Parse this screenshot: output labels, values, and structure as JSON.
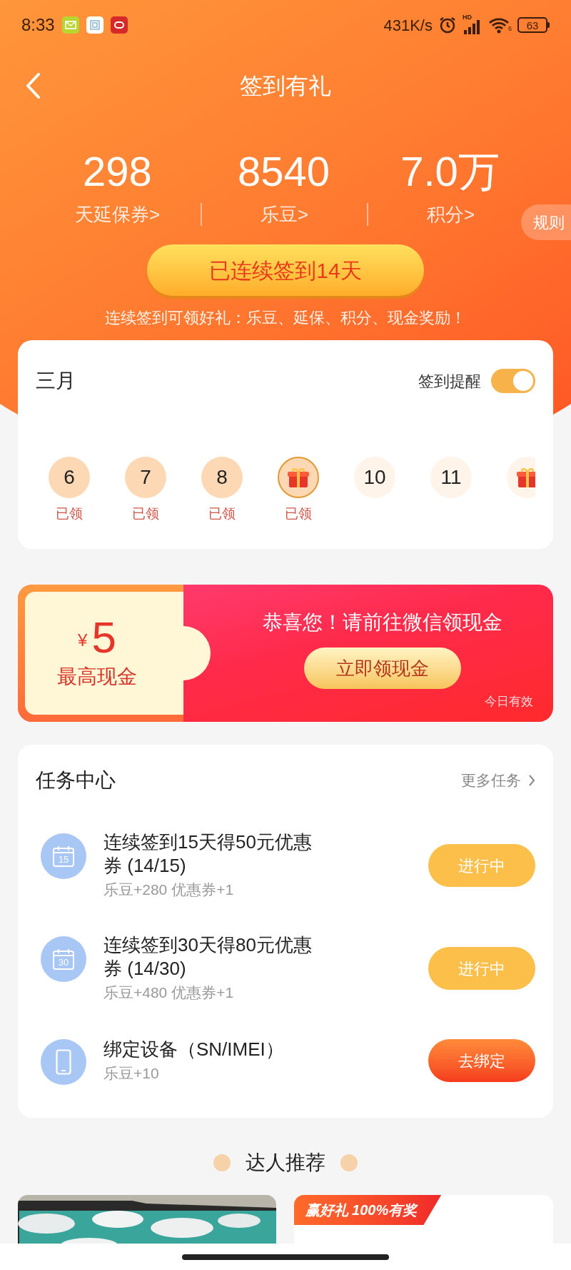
{
  "status_bar": {
    "time": "8:33",
    "speed": "431K/s",
    "signal_label": "HD",
    "wifi_label": "6",
    "battery": "63"
  },
  "header": {
    "title": "签到有礼"
  },
  "stats": [
    {
      "value": "298",
      "label": "天延保券>"
    },
    {
      "value": "8540",
      "label": "乐豆>"
    },
    {
      "value": "7.0万",
      "label": "积分>"
    }
  ],
  "rules_tab": "规则",
  "streak_button": "已连续签到14天",
  "subtitle": "连续签到可领好礼：乐豆、延保、积分、现金奖励！",
  "calendar": {
    "month": "三月",
    "reminder_label": "签到提醒",
    "reminder_on": true,
    "days": [
      {
        "kind": "number",
        "day": "6",
        "claimed": true,
        "today": false,
        "label": "已领"
      },
      {
        "kind": "number",
        "day": "7",
        "claimed": true,
        "today": false,
        "label": "已领"
      },
      {
        "kind": "number",
        "day": "8",
        "claimed": true,
        "today": false,
        "label": "已领"
      },
      {
        "kind": "gift",
        "claimed": true,
        "today": true,
        "label": "已领"
      },
      {
        "kind": "number",
        "day": "10",
        "claimed": false,
        "today": false
      },
      {
        "kind": "number",
        "day": "11",
        "claimed": false,
        "today": false
      },
      {
        "kind": "gift",
        "claimed": false,
        "today": false
      }
    ]
  },
  "cash_banner": {
    "currency": "¥",
    "amount": "5",
    "amount_label": "最高现金",
    "message": "恭喜您！请前往微信领现金",
    "button": "立即领现金",
    "note": "今日有效"
  },
  "task_center": {
    "title": "任务中心",
    "more": "更多任务",
    "tasks": [
      {
        "kind": "calendar",
        "icon_text": "15",
        "title": "连续签到15天得50元优惠券 (14/15)",
        "reward": "乐豆+280 优惠券+1",
        "button": "进行中",
        "in_progress": true
      },
      {
        "kind": "calendar",
        "icon_text": "30",
        "title": "连续签到30天得80元优惠券 (14/30)",
        "reward": "乐豆+480 优惠券+1",
        "button": "进行中",
        "in_progress": true
      },
      {
        "kind": "phone",
        "title": "绑定设备（SN/IMEI）",
        "reward": "乐豆+10",
        "button": "去绑定",
        "in_progress": false
      }
    ]
  },
  "recommend": {
    "title": "达人推荐",
    "cards": [
      {
        "kind": "picture"
      },
      {
        "kind": "promo",
        "tag": "赢好礼 100%有奖"
      }
    ]
  }
}
